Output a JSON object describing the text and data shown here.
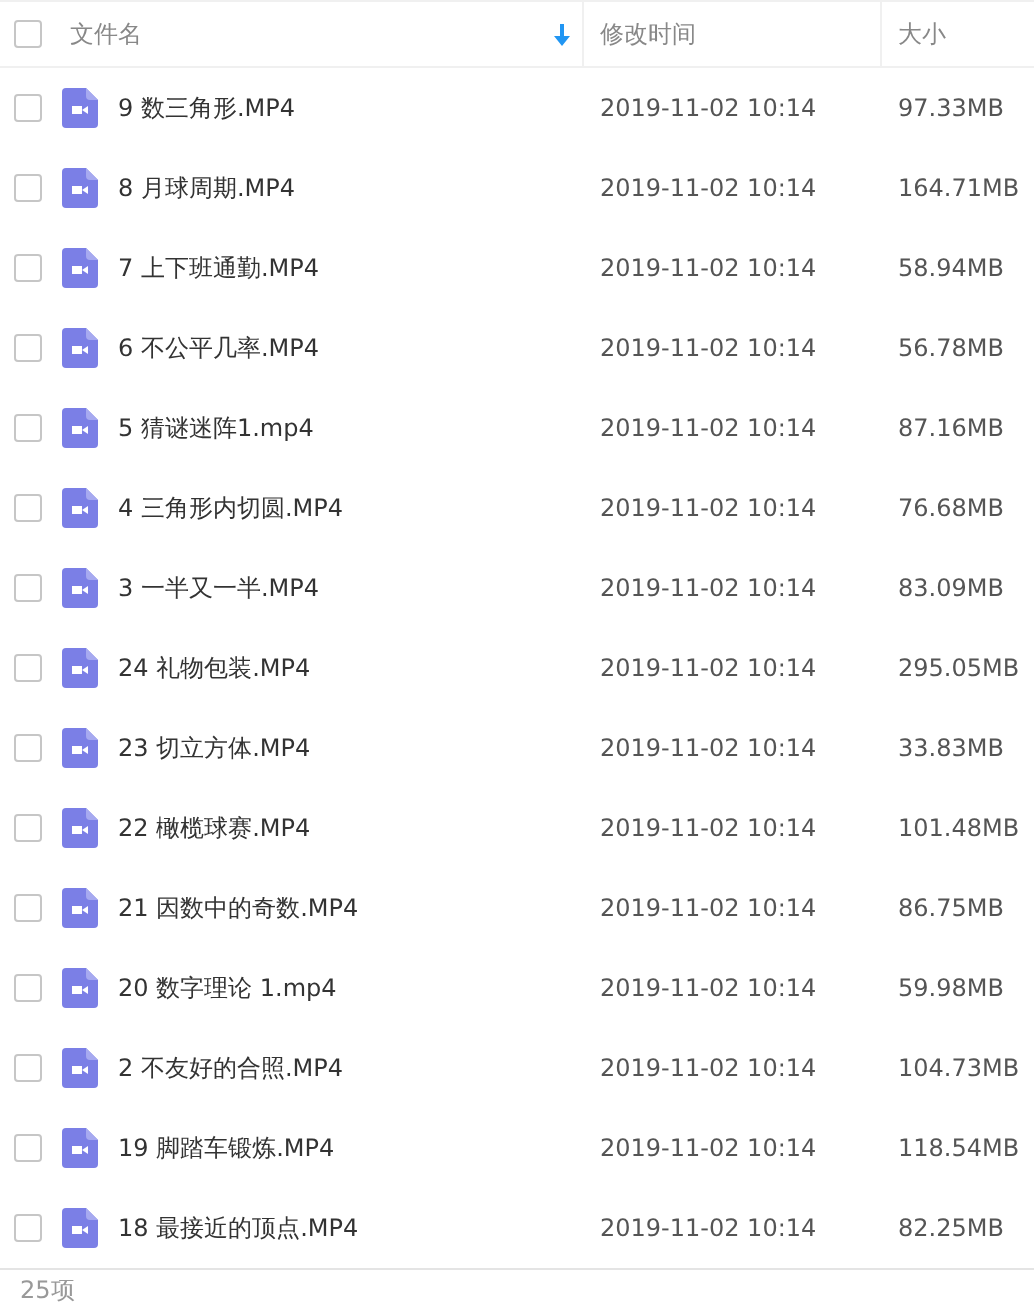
{
  "header": {
    "checked": false,
    "columns": [
      {
        "label": "文件名",
        "sorted": true
      },
      {
        "label": "修改时间",
        "sorted": false
      },
      {
        "label": "大小",
        "sorted": false
      }
    ]
  },
  "rows": [
    {
      "name": "9 数三角形.MP4",
      "modified": "2019-11-02 10:14",
      "size": "97.33MB",
      "checked": false
    },
    {
      "name": "8 月球周期.MP4",
      "modified": "2019-11-02 10:14",
      "size": "164.71MB",
      "checked": false
    },
    {
      "name": "7 上下班通勤.MP4",
      "modified": "2019-11-02 10:14",
      "size": "58.94MB",
      "checked": false
    },
    {
      "name": "6 不公平几率.MP4",
      "modified": "2019-11-02 10:14",
      "size": "56.78MB",
      "checked": false
    },
    {
      "name": "5 猜谜迷阵1.mp4",
      "modified": "2019-11-02 10:14",
      "size": "87.16MB",
      "checked": false
    },
    {
      "name": "4 三角形内切圆.MP4",
      "modified": "2019-11-02 10:14",
      "size": "76.68MB",
      "checked": false
    },
    {
      "name": "3 一半又一半.MP4",
      "modified": "2019-11-02 10:14",
      "size": "83.09MB",
      "checked": false
    },
    {
      "name": "24 礼物包装.MP4",
      "modified": "2019-11-02 10:14",
      "size": "295.05MB",
      "checked": false
    },
    {
      "name": "23 切立方体.MP4",
      "modified": "2019-11-02 10:14",
      "size": "33.83MB",
      "checked": false
    },
    {
      "name": "22 橄榄球赛.MP4",
      "modified": "2019-11-02 10:14",
      "size": "101.48MB",
      "checked": false
    },
    {
      "name": "21 因数中的奇数.MP4",
      "modified": "2019-11-02 10:14",
      "size": "86.75MB",
      "checked": false
    },
    {
      "name": "20 数字理论 1.mp4",
      "modified": "2019-11-02 10:14",
      "size": "59.98MB",
      "checked": false
    },
    {
      "name": "2 不友好的合照.MP4",
      "modified": "2019-11-02 10:14",
      "size": "104.73MB",
      "checked": false
    },
    {
      "name": "19 脚踏车锻炼.MP4",
      "modified": "2019-11-02 10:14",
      "size": "118.54MB",
      "checked": false
    },
    {
      "name": "18 最接近的顶点.MP4",
      "modified": "2019-11-02 10:14",
      "size": "82.25MB",
      "checked": false
    }
  ],
  "status_bar": "25项"
}
